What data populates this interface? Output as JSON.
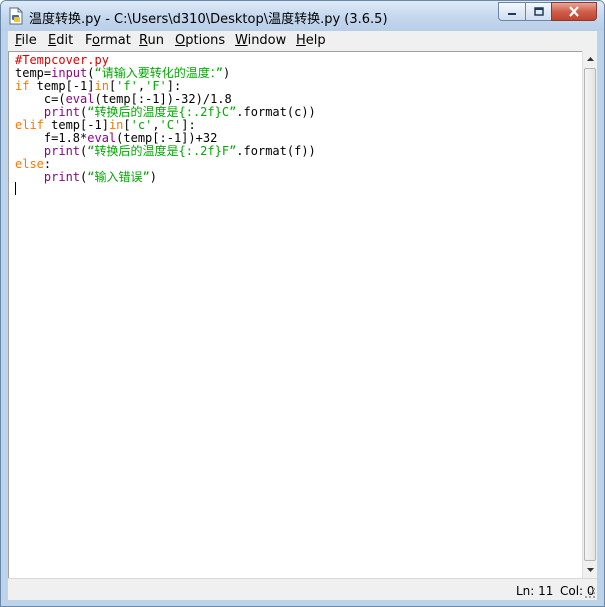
{
  "window": {
    "title": "温度转换.py - C:\\Users\\d310\\Desktop\\温度转换.py (3.6.5)"
  },
  "menu": [
    {
      "key": "F",
      "rest": "ile"
    },
    {
      "key": "E",
      "rest": "dit"
    },
    {
      "pre": "F",
      "key": "o",
      "rest": "rmat"
    },
    {
      "key": "R",
      "rest": "un"
    },
    {
      "key": "O",
      "rest": "ptions"
    },
    {
      "key": "W",
      "rest": "indow"
    },
    {
      "key": "H",
      "rest": "elp"
    }
  ],
  "code": {
    "lines": [
      [
        {
          "t": "cm",
          "v": "#Tempcover.py"
        }
      ],
      [
        {
          "t": "df",
          "v": "temp="
        },
        {
          "t": "bi",
          "v": "input"
        },
        {
          "t": "df",
          "v": "("
        },
        {
          "t": "st",
          "v": "“请输入要转化的温度：”"
        },
        {
          "t": "df",
          "v": ")"
        }
      ],
      [
        {
          "t": "kw",
          "v": "if"
        },
        {
          "t": "df",
          "v": " temp[-1]"
        },
        {
          "t": "kw",
          "v": "in"
        },
        {
          "t": "df",
          "v": "["
        },
        {
          "t": "st",
          "v": "'f'"
        },
        {
          "t": "df",
          "v": ","
        },
        {
          "t": "st",
          "v": "'F'"
        },
        {
          "t": "df",
          "v": "]:"
        }
      ],
      [
        {
          "t": "df",
          "v": "    c=("
        },
        {
          "t": "bi",
          "v": "eval"
        },
        {
          "t": "df",
          "v": "(temp[:-1])-32)/1.8"
        }
      ],
      [
        {
          "t": "df",
          "v": "    "
        },
        {
          "t": "bi",
          "v": "print"
        },
        {
          "t": "df",
          "v": "("
        },
        {
          "t": "st",
          "v": "“转换后的温度是{:.2f}C”"
        },
        {
          "t": "df",
          "v": ".format(c))"
        }
      ],
      [
        {
          "t": "kw",
          "v": "elif"
        },
        {
          "t": "df",
          "v": " temp[-1]"
        },
        {
          "t": "kw",
          "v": "in"
        },
        {
          "t": "df",
          "v": "["
        },
        {
          "t": "st",
          "v": "'c'"
        },
        {
          "t": "df",
          "v": ","
        },
        {
          "t": "st",
          "v": "'C'"
        },
        {
          "t": "df",
          "v": "]:"
        }
      ],
      [
        {
          "t": "df",
          "v": "    f=1.8*"
        },
        {
          "t": "bi",
          "v": "eval"
        },
        {
          "t": "df",
          "v": "(temp[:-1])+32"
        }
      ],
      [
        {
          "t": "df",
          "v": "    "
        },
        {
          "t": "bi",
          "v": "print"
        },
        {
          "t": "df",
          "v": "("
        },
        {
          "t": "st",
          "v": "“转换后的温度是{:.2f}F”"
        },
        {
          "t": "df",
          "v": ".format(f))"
        }
      ],
      [
        {
          "t": "kw",
          "v": "else"
        },
        {
          "t": "df",
          "v": ":"
        }
      ],
      [
        {
          "t": "df",
          "v": "    "
        },
        {
          "t": "bi",
          "v": "print"
        },
        {
          "t": "df",
          "v": "("
        },
        {
          "t": "st",
          "v": "“输入错误”"
        },
        {
          "t": "df",
          "v": ")"
        }
      ]
    ]
  },
  "status": {
    "line": "Ln: 11",
    "col": "Col: 0"
  },
  "icons": {
    "app": "idle-file-icon",
    "minimize": "minimize-icon",
    "maximize": "maximize-icon",
    "close": "close-icon",
    "scroll_up": "arrow-up-icon",
    "scroll_down": "arrow-down-icon",
    "grip": "resize-grip-icon"
  },
  "colors": {
    "keyword": "#ff7700",
    "builtin": "#900090",
    "string": "#00aa00",
    "comment": "#dd0000",
    "close_button": "#c0432e"
  }
}
